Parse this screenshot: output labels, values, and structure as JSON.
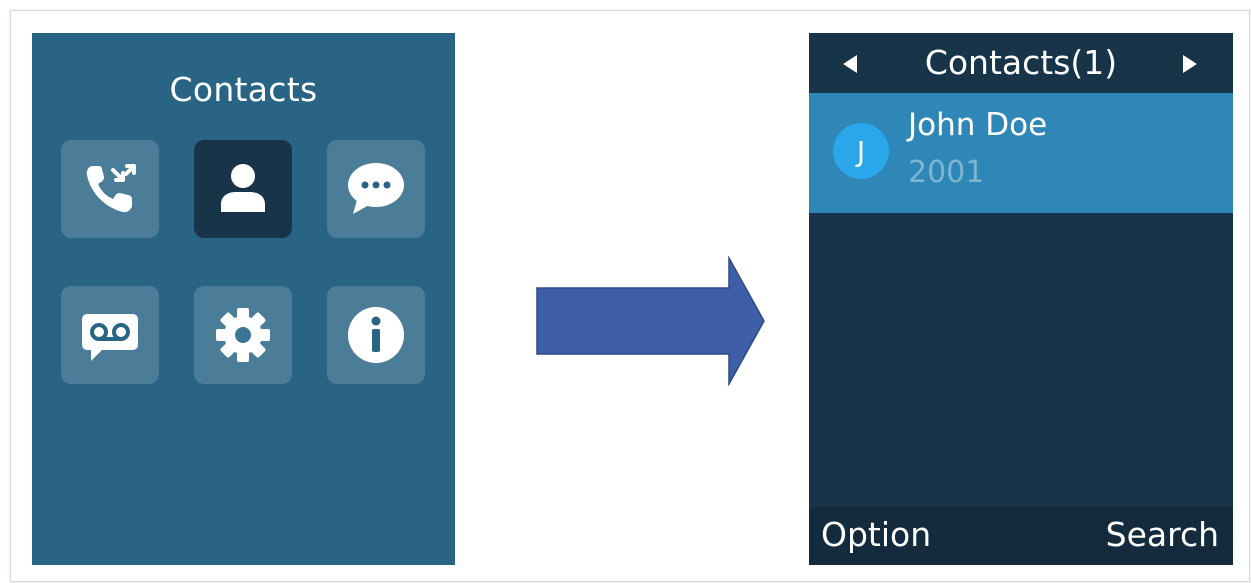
{
  "left_screen": {
    "title": "Contacts",
    "menu_icons": [
      "call-history-icon",
      "contacts-icon",
      "messages-icon",
      "voicemail-icon",
      "settings-icon",
      "info-icon"
    ],
    "selected_icon": "contacts-icon"
  },
  "arrow_color": "#3e5fa8",
  "right_screen": {
    "title": "Contacts(1)",
    "contact": {
      "initial": "J",
      "name": "John Doe",
      "number": "2001"
    },
    "softkey_left": "Option",
    "softkey_right": "Search"
  },
  "colors": {
    "menu_background": "#296485",
    "selected_tile": "#183448",
    "list_background": "#19344a",
    "highlight_row": "#2e87b6",
    "avatar": "#2aa6ea"
  }
}
